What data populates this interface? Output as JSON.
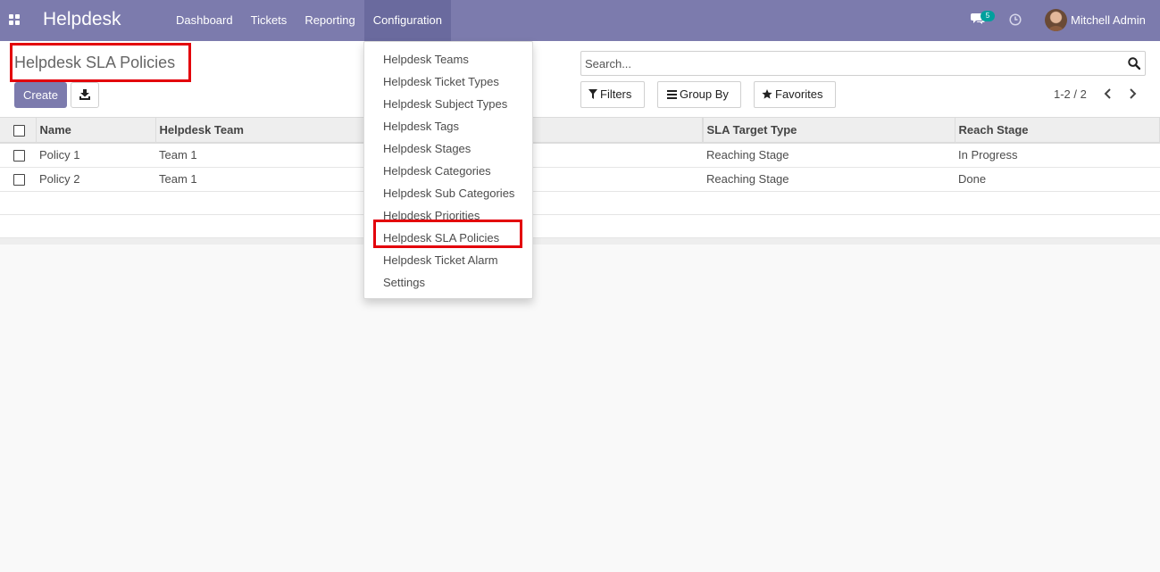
{
  "navbar": {
    "brand": "Helpdesk",
    "menu": [
      "Dashboard",
      "Tickets",
      "Reporting",
      "Configuration"
    ],
    "active_menu": "Configuration",
    "chat_badge": "5",
    "user_name": "Mitchell Admin"
  },
  "control_panel": {
    "title": "Helpdesk SLA Policies",
    "create_label": "Create",
    "search_placeholder": "Search...",
    "filters_label": "Filters",
    "group_by_label": "Group By",
    "favorites_label": "Favorites",
    "pager": "1-2 / 2"
  },
  "table": {
    "columns": [
      "Name",
      "Helpdesk Team",
      "",
      "SLA Target Type",
      "Reach Stage"
    ],
    "rows": [
      [
        "Policy 1",
        "Team 1",
        "",
        "Reaching Stage",
        "In Progress"
      ],
      [
        "Policy 2",
        "Team 1",
        "",
        "Reaching Stage",
        "Done"
      ]
    ]
  },
  "dropdown": {
    "items": [
      "Helpdesk Teams",
      "Helpdesk Ticket Types",
      "Helpdesk Subject Types",
      "Helpdesk Tags",
      "Helpdesk Stages",
      "Helpdesk Categories",
      "Helpdesk Sub Categories",
      "Helpdesk Priorities",
      "Helpdesk SLA Policies",
      "Helpdesk Ticket Alarm",
      "Settings"
    ],
    "highlighted": "Helpdesk SLA Policies"
  },
  "colors": {
    "navbar": "#7c7bad",
    "navbar_active": "#6a6a9e",
    "badge": "#00a09d",
    "highlight": "#e3000b"
  },
  "icons": [
    "apps-icon",
    "chat-icon",
    "clock-icon",
    "download-icon",
    "search-icon",
    "filter-icon",
    "group-by-icon",
    "star-icon",
    "chevron-left-icon",
    "chevron-right-icon"
  ]
}
